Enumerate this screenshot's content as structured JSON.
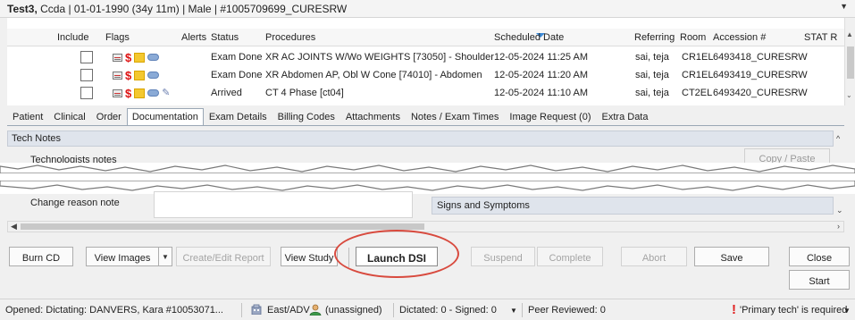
{
  "header": {
    "patient_name": "Test3,",
    "patient_rest": " Ccda  |  01-01-1990 (34y 11m)  |  Male  |  #1005709699_CURESRW",
    "collapse_icon": "triangle-down-icon"
  },
  "table": {
    "columns": [
      "Include",
      "Flags",
      "Alerts",
      "Status",
      "Procedures",
      "Scheduled Date",
      "Referring",
      "Room",
      "Accession #",
      "STAT R"
    ],
    "rows": [
      {
        "status": "Exam Done",
        "procedure": "XR AC JOINTS W/Wo WEIGHTS [73050] - Shoulder",
        "scheduled": "12-05-2024 11:25 AM",
        "referring": "sai, teja",
        "room": "CR1EL",
        "accession": "6493418_CURESRW",
        "has_pen": false
      },
      {
        "status": "Exam Done",
        "procedure": "XR Abdomen AP, Obl W Cone [74010] - Abdomen",
        "scheduled": "12-05-2024 11:20 AM",
        "referring": "sai, teja",
        "room": "CR1EL",
        "accession": "6493419_CURESRW",
        "has_pen": false
      },
      {
        "status": "Arrived",
        "procedure": "CT 4 Phase [ct04]",
        "scheduled": "12-05-2024 11:10 AM",
        "referring": "sai, teja",
        "room": "CT2EL",
        "accession": "6493420_CURESRW",
        "has_pen": true
      }
    ],
    "flag_icons": [
      "document-icon",
      "dollar-icon",
      "sticky-note-icon",
      "pill-icon",
      "pencil-icon"
    ]
  },
  "tabs": [
    {
      "label": "Patient",
      "active": false
    },
    {
      "label": "Clinical",
      "active": false
    },
    {
      "label": "Order",
      "active": false
    },
    {
      "label": "Documentation",
      "active": true
    },
    {
      "label": "Exam Details",
      "active": false
    },
    {
      "label": "Billing Codes",
      "active": false
    },
    {
      "label": "Attachments",
      "active": false
    },
    {
      "label": "Notes / Exam Times",
      "active": false
    },
    {
      "label": "Image Request (0)",
      "active": false
    },
    {
      "label": "Extra Data",
      "active": false
    }
  ],
  "documentation": {
    "section_title": "Tech Notes",
    "technologists_notes_label": "Technologists notes",
    "copy_paste_label": "Copy / Paste",
    "change_reason_label": "Change reason note",
    "signs_symptoms_label": "Signs and Symptoms"
  },
  "buttons": {
    "burn_cd": "Burn CD",
    "view_images": "View Images",
    "create_edit_report": "Create/Edit Report",
    "view_study": "View Study",
    "launch_dsi": "Launch DSI",
    "suspend": "Suspend",
    "complete": "Complete",
    "abort": "Abort",
    "save": "Save",
    "close": "Close",
    "start": "Start"
  },
  "status_bar": {
    "opened": "Opened: Dictating: DANVERS, Kara #10053071...",
    "location": "East/ADV",
    "assignee": "(unassigned)",
    "dictated": "Dictated: 0 - Signed: 0",
    "peer_reviewed": "Peer Reviewed: 0",
    "warning": "'Primary tech' is required",
    "warning_color": "#e02222"
  },
  "accent": {
    "highlight_ellipse": "#d84a3e",
    "sort_indicator": "#3d8bd9"
  }
}
